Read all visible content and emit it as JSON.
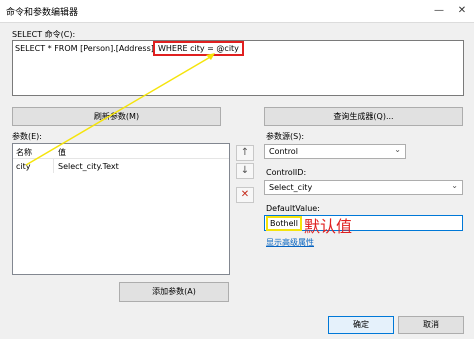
{
  "window": {
    "title": "命令和参数编辑器",
    "minimize": "—",
    "close": "✕"
  },
  "command": {
    "label": "SELECT 命令(C):",
    "sql_prefix": "SELECT * FROM [Person].[Address]",
    "sql_highlight": "WHERE city = @city"
  },
  "buttons": {
    "refresh": "刷新参数(M)",
    "query_builder": "查询生成器(Q)...",
    "add_param": "添加参数(A)",
    "ok": "确定",
    "cancel": "取消"
  },
  "params": {
    "label": "参数(E):",
    "columns": [
      "名称",
      "值"
    ],
    "rows": [
      {
        "name": "city",
        "value": "Select_city.Text"
      }
    ]
  },
  "side_buttons": {
    "up": "↑",
    "down": "↓",
    "delete": "✕"
  },
  "source": {
    "label": "参数源(S):",
    "value": "Control",
    "control_id_label": "ControlID:",
    "control_id": "Select_city",
    "default_label": "DefaultValue:",
    "default_value": "Bothell",
    "advanced_link": "显示高级属性"
  },
  "annotation": "默认值",
  "colors": {
    "highlight_red": "#e02020",
    "annot_yellow": "#f5e40b",
    "accent": "#0078d7"
  }
}
